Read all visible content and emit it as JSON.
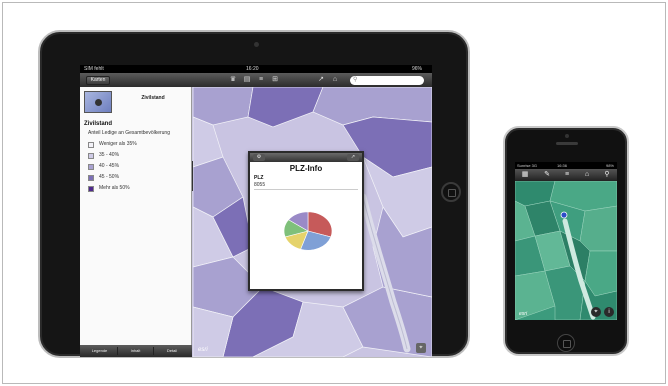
{
  "ipad": {
    "status": {
      "carrier": "SIM fehlt",
      "time": "16:20",
      "battery": "96%"
    },
    "nav": {
      "back_label": "Karten",
      "search_placeholder": ""
    },
    "panel": {
      "heading": "Zivilstand",
      "title": "Zivilstand",
      "subtitle": "Anteil Ledige an Gesamtbevölkerung",
      "legend": [
        {
          "label": "Weniger als 35%",
          "color": "#f3f2f8"
        },
        {
          "label": "35 - 40%",
          "color": "#cfcbe6"
        },
        {
          "label": "40 - 45%",
          "color": "#a8a1d0"
        },
        {
          "label": "45 - 50%",
          "color": "#7c6fb6"
        },
        {
          "label": "Mehr als 50%",
          "color": "#4f2a8c"
        }
      ],
      "tabs": [
        "Legende",
        "Inhalt",
        "Detail"
      ]
    },
    "map": {
      "attribution": "esri"
    },
    "popup": {
      "title": "PLZ-Info",
      "key": "PLZ",
      "value": "8055",
      "pie": [
        {
          "value": 30,
          "color": "#c65a5a"
        },
        {
          "value": 25,
          "color": "#7fa0d6"
        },
        {
          "value": 15,
          "color": "#e5d36b"
        },
        {
          "value": 15,
          "color": "#7fc07a"
        },
        {
          "value": 15,
          "color": "#9a8ac7"
        }
      ]
    }
  },
  "iphone": {
    "status": {
      "carrier": "Sunrise 3G",
      "time": "16:36",
      "battery": "98%"
    },
    "map": {
      "attribution": "esri"
    }
  }
}
